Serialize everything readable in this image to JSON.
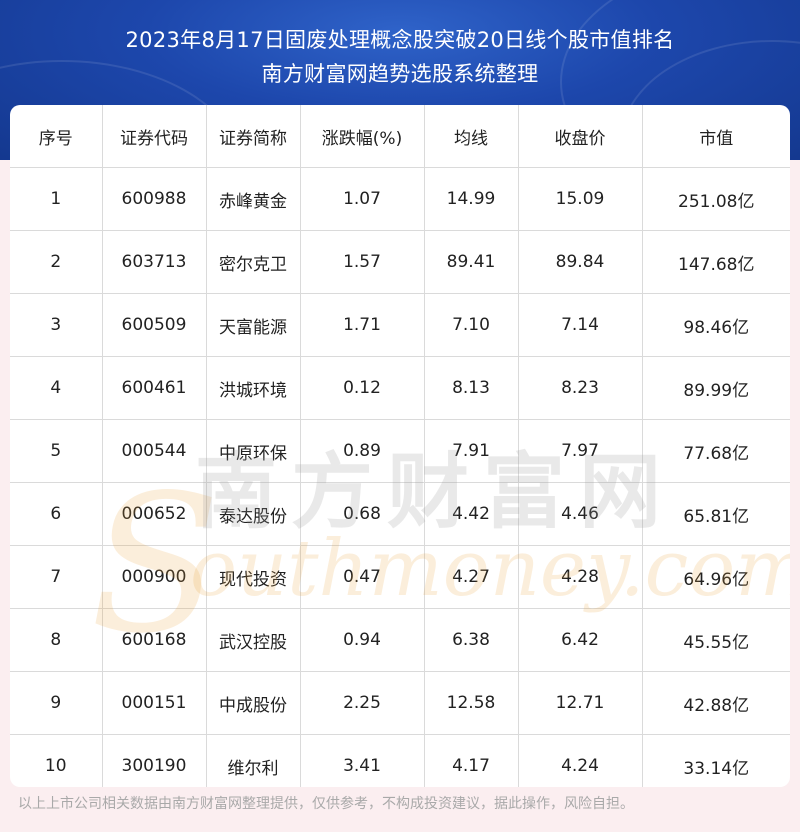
{
  "title": {
    "line1": "2023年8月17日固废处理概念股突破20日线个股市值排名",
    "line2": "南方财富网趋势选股系统整理"
  },
  "table": {
    "headers": [
      "序号",
      "证券代码",
      "证券简称",
      "涨跌幅(%)",
      "均线",
      "收盘价",
      "市值"
    ],
    "rows": [
      [
        "1",
        "600988",
        "赤峰黄金",
        "1.07",
        "14.99",
        "15.09",
        "251.08亿"
      ],
      [
        "2",
        "603713",
        "密尔克卫",
        "1.57",
        "89.41",
        "89.84",
        "147.68亿"
      ],
      [
        "3",
        "600509",
        "天富能源",
        "1.71",
        "7.10",
        "7.14",
        "98.46亿"
      ],
      [
        "4",
        "600461",
        "洪城环境",
        "0.12",
        "8.13",
        "8.23",
        "89.99亿"
      ],
      [
        "5",
        "000544",
        "中原环保",
        "0.89",
        "7.91",
        "7.97",
        "77.68亿"
      ],
      [
        "6",
        "000652",
        "泰达股份",
        "0.68",
        "4.42",
        "4.46",
        "65.81亿"
      ],
      [
        "7",
        "000900",
        "现代投资",
        "0.47",
        "4.27",
        "4.28",
        "64.96亿"
      ],
      [
        "8",
        "600168",
        "武汉控股",
        "0.94",
        "6.38",
        "6.42",
        "45.55亿"
      ],
      [
        "9",
        "000151",
        "中成股份",
        "2.25",
        "12.58",
        "12.71",
        "42.88亿"
      ],
      [
        "10",
        "300190",
        "维尔利",
        "3.41",
        "4.17",
        "4.24",
        "33.14亿"
      ]
    ]
  },
  "watermark": {
    "cn": "南方财富网",
    "en": "outhmoney.com",
    "letter": "S"
  },
  "footer": {
    "disclaimer": "以上上市公司相关数据由南方财富网整理提供，仅供参考，不构成投资建议，据此操作，风险自担。"
  },
  "colors": {
    "header_blue": "#1d47ac",
    "page_bg": "#fbeef0",
    "text": "#222222",
    "footer_text": "#a9a9a9"
  }
}
